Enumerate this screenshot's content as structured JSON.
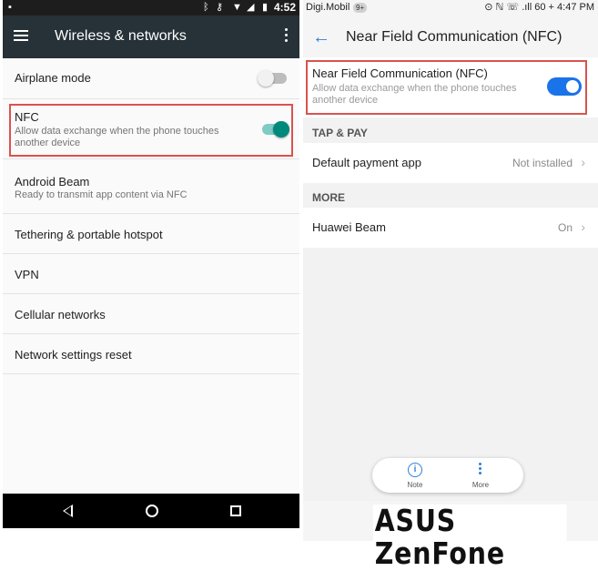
{
  "left": {
    "status": {
      "time": "4:52",
      "icons": [
        "image-icon",
        "bluetooth-icon",
        "key-icon",
        "wifi-icon",
        "signal-icon",
        "battery-icon"
      ]
    },
    "toolbar": {
      "title": "Wireless & networks"
    },
    "items": [
      {
        "title": "Airplane mode",
        "toggle": "off"
      },
      {
        "title": "NFC",
        "subtitle": "Allow data exchange when the phone touches another device",
        "toggle": "on"
      },
      {
        "title": "Android Beam",
        "subtitle": "Ready to transmit app content via NFC"
      },
      {
        "title": "Tethering & portable hotspot"
      },
      {
        "title": "VPN"
      },
      {
        "title": "Cellular networks"
      },
      {
        "title": "Network settings reset"
      }
    ],
    "colors": {
      "toolbar": "#263238",
      "toggle_on": "#00897b",
      "toggle_off": "#bdbdbd",
      "highlight": "#d9534f"
    }
  },
  "right": {
    "status": {
      "carrier": "Digi.Mobil",
      "badge": "9+",
      "right": "⊙ ℕ ☏ .ıll 60 + 4:47 PM"
    },
    "header": {
      "back": "←",
      "title": "Near Field Communication (NFC)"
    },
    "nfc": {
      "title": "Near Field Communication (NFC)",
      "subtitle": "Allow data exchange when the phone touches another device",
      "toggle": "on"
    },
    "sections": [
      {
        "header": "TAP & PAY",
        "items": [
          {
            "title": "Default payment app",
            "value": "Not installed"
          }
        ]
      },
      {
        "header": "MORE",
        "items": [
          {
            "title": "Huawei Beam",
            "value": "On"
          }
        ]
      }
    ],
    "bottombar": {
      "note_label": "Note",
      "more_label": "More",
      "info_glyph": "i"
    },
    "colors": {
      "accent": "#2f7fd8",
      "toggle_on": "#1a73e8"
    }
  },
  "watermark": "ASUS ZenFone"
}
